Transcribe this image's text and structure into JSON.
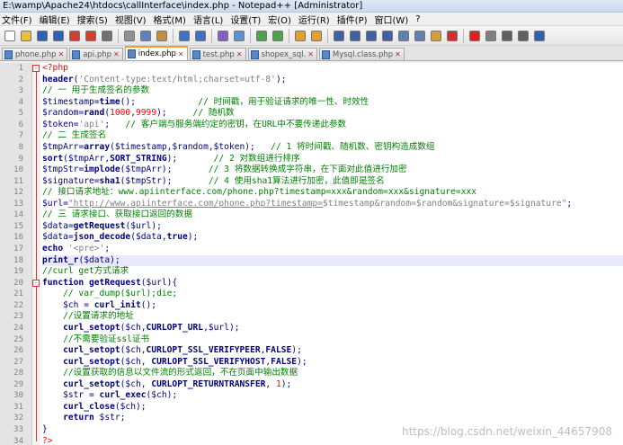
{
  "window": {
    "title": "E:\\wamp\\Apache24\\htdocs\\callInterface\\index.php - Notepad++ [Administrator]"
  },
  "menu": [
    "文件(F)",
    "编辑(E)",
    "搜索(S)",
    "视图(V)",
    "格式(M)",
    "语言(L)",
    "设置(T)",
    "宏(O)",
    "运行(R)",
    "插件(P)",
    "窗口(W)",
    "?"
  ],
  "toolbar_icons": [
    {
      "name": "new-file-icon",
      "color": "#ffffff"
    },
    {
      "name": "open-file-icon",
      "color": "#e8c040"
    },
    {
      "name": "save-icon",
      "color": "#3060b0"
    },
    {
      "name": "save-all-icon",
      "color": "#3060b0"
    },
    {
      "name": "close-icon",
      "color": "#d04030"
    },
    {
      "name": "close-all-icon",
      "color": "#d04030"
    },
    {
      "name": "print-icon",
      "color": "#707070"
    },
    {
      "sep": true
    },
    {
      "name": "cut-icon",
      "color": "#909090"
    },
    {
      "name": "copy-icon",
      "color": "#6080c0"
    },
    {
      "name": "paste-icon",
      "color": "#c09040"
    },
    {
      "sep": true
    },
    {
      "name": "undo-icon",
      "color": "#4070c0"
    },
    {
      "name": "redo-icon",
      "color": "#4070c0"
    },
    {
      "sep": true
    },
    {
      "name": "find-icon",
      "color": "#8060c0"
    },
    {
      "name": "replace-icon",
      "color": "#6090d0"
    },
    {
      "sep": true
    },
    {
      "name": "zoom-in-icon",
      "color": "#50a050"
    },
    {
      "name": "zoom-out-icon",
      "color": "#50a050"
    },
    {
      "sep": true
    },
    {
      "name": "sync-v-icon",
      "color": "#e0a030"
    },
    {
      "name": "sync-h-icon",
      "color": "#e0a030"
    },
    {
      "sep": true
    },
    {
      "name": "word-wrap-icon",
      "color": "#4060a0"
    },
    {
      "name": "all-chars-icon",
      "color": "#4060a0"
    },
    {
      "name": "indent-guide-icon",
      "color": "#4060a0"
    },
    {
      "name": "user-lang-icon",
      "color": "#4060a0"
    },
    {
      "name": "doc-map-icon",
      "color": "#6080b0"
    },
    {
      "name": "function-list-icon",
      "color": "#6080b0"
    },
    {
      "name": "folder-workspace-icon",
      "color": "#d0a040"
    },
    {
      "name": "monitor-icon",
      "color": "#d03030"
    },
    {
      "sep": true
    },
    {
      "name": "record-macro-icon",
      "color": "#e02020"
    },
    {
      "name": "stop-macro-icon",
      "color": "#808080"
    },
    {
      "name": "play-macro-icon",
      "color": "#606060"
    },
    {
      "name": "run-macro-icon",
      "color": "#606060"
    },
    {
      "name": "save-macro-icon",
      "color": "#3060b0"
    }
  ],
  "tabs": [
    {
      "label": "phone.php",
      "active": false
    },
    {
      "label": "api.php",
      "active": false
    },
    {
      "label": "index.php",
      "active": true
    },
    {
      "label": "test.php",
      "active": false
    },
    {
      "label": "shopex_sql.",
      "active": false
    },
    {
      "label": "Mysql.class.php",
      "active": false
    }
  ],
  "code_lines": [
    [
      [
        "c-php",
        "<?php"
      ]
    ],
    [
      [
        "c-kw",
        "header"
      ],
      [
        "c-plain",
        "("
      ],
      [
        "c-str",
        "'Content-type:text/html;charset=utf-8'"
      ],
      [
        "c-plain",
        ");"
      ]
    ],
    [
      [
        "c-com",
        "// 一 用于生成签名的参数"
      ]
    ],
    [
      [
        "c-var",
        "$timestamp"
      ],
      [
        "c-plain",
        "="
      ],
      [
        "c-kw",
        "time"
      ],
      [
        "c-plain",
        "();            "
      ],
      [
        "c-com",
        "// 时间戳，用于验证请求的唯一性、时效性"
      ]
    ],
    [
      [
        "c-var",
        "$random"
      ],
      [
        "c-plain",
        "="
      ],
      [
        "c-kw",
        "rand"
      ],
      [
        "c-plain",
        "("
      ],
      [
        "c-num",
        "1000"
      ],
      [
        "c-plain",
        ","
      ],
      [
        "c-num",
        "9999"
      ],
      [
        "c-plain",
        ");     "
      ],
      [
        "c-com",
        "// 随机数"
      ]
    ],
    [
      [
        "c-var",
        "$token"
      ],
      [
        "c-plain",
        "="
      ],
      [
        "c-str",
        "'api'"
      ],
      [
        "c-plain",
        ";   "
      ],
      [
        "c-com",
        "// 客户端与服务端约定的密钥，在URL中不要传递此参数"
      ]
    ],
    [
      [
        "c-com",
        "// 二 生成签名"
      ]
    ],
    [
      [
        "c-var",
        "$tmpArr"
      ],
      [
        "c-plain",
        "="
      ],
      [
        "c-kw",
        "array"
      ],
      [
        "c-plain",
        "($timestamp,$random,$token);   "
      ],
      [
        "c-com",
        "// 1 将时间戳、随机数、密钥构造成数组"
      ]
    ],
    [
      [
        "c-kw",
        "sort"
      ],
      [
        "c-plain",
        "($tmpArr,"
      ],
      [
        "c-kw",
        "SORT_STRING"
      ],
      [
        "c-plain",
        ");       "
      ],
      [
        "c-com",
        "// 2 对数组进行排序"
      ]
    ],
    [
      [
        "c-var",
        "$tmpStr"
      ],
      [
        "c-plain",
        "="
      ],
      [
        "c-kw",
        "implode"
      ],
      [
        "c-plain",
        "($tmpArr);       "
      ],
      [
        "c-com",
        "// 3 将数据转换成字符串，在下面对此值进行加密"
      ]
    ],
    [
      [
        "c-var",
        "$signature"
      ],
      [
        "c-plain",
        "="
      ],
      [
        "c-kw",
        "sha1"
      ],
      [
        "c-plain",
        "($tmpStr);       "
      ],
      [
        "c-com",
        "// 4 使用sha1算法进行加密，此值即是签名"
      ]
    ],
    [
      [
        "c-com",
        "// 接口请求地址：www.apiinterface.com/phone.php?timestamp=xxx&random=xxx&signature=xxx"
      ]
    ],
    [
      [
        "c-var",
        "$url"
      ],
      [
        "c-plain",
        "="
      ],
      [
        "c-url",
        "\"http://www.apiinterface.com/phone.php?timestamp="
      ],
      [
        "c-str",
        "$timestamp&random=$random&signature=$signature\""
      ],
      [
        "c-plain",
        ";"
      ]
    ],
    [
      [
        "c-com",
        "// 三 请求接口、获取接口返回的数据"
      ]
    ],
    [
      [
        "c-var",
        "$data"
      ],
      [
        "c-plain",
        "="
      ],
      [
        "c-kw",
        "getRequest"
      ],
      [
        "c-plain",
        "($url);"
      ]
    ],
    [
      [
        "c-var",
        "$data"
      ],
      [
        "c-plain",
        "="
      ],
      [
        "c-kw",
        "json_decode"
      ],
      [
        "c-plain",
        "($data,"
      ],
      [
        "c-kw",
        "true"
      ],
      [
        "c-plain",
        ");"
      ]
    ],
    [
      [
        "c-kw",
        "echo"
      ],
      [
        "c-plain",
        " "
      ],
      [
        "c-str",
        "'<pre>'"
      ],
      [
        "c-plain",
        ";"
      ]
    ],
    [
      [
        "c-kw",
        "print_r"
      ],
      [
        "c-plain",
        "($data);"
      ]
    ],
    [
      [
        "c-com",
        "//curl get方式请求"
      ]
    ],
    [
      [
        "c-kw",
        "function"
      ],
      [
        "c-plain",
        " "
      ],
      [
        "c-kw",
        "getRequest"
      ],
      [
        "c-plain",
        "($url){"
      ]
    ],
    [
      [
        "c-plain",
        "    "
      ],
      [
        "c-com",
        "// var_dump($url);die;"
      ]
    ],
    [
      [
        "c-plain",
        "    "
      ],
      [
        "c-var",
        "$ch"
      ],
      [
        "c-plain",
        " = "
      ],
      [
        "c-kw",
        "curl_init"
      ],
      [
        "c-plain",
        "();"
      ]
    ],
    [
      [
        "c-plain",
        "    "
      ],
      [
        "c-com",
        "//设置请求的地址"
      ]
    ],
    [
      [
        "c-plain",
        "    "
      ],
      [
        "c-kw",
        "curl_setopt"
      ],
      [
        "c-plain",
        "($ch,"
      ],
      [
        "c-kw",
        "CURLOPT_URL"
      ],
      [
        "c-plain",
        ",$url);"
      ]
    ],
    [
      [
        "c-plain",
        "    "
      ],
      [
        "c-com",
        "//不需要验证ssl证书"
      ]
    ],
    [
      [
        "c-plain",
        "    "
      ],
      [
        "c-kw",
        "curl_setopt"
      ],
      [
        "c-plain",
        "($ch,"
      ],
      [
        "c-kw",
        "CURLOPT_SSL_VERIFYPEER"
      ],
      [
        "c-plain",
        ","
      ],
      [
        "c-kw",
        "FALSE"
      ],
      [
        "c-plain",
        ");"
      ]
    ],
    [
      [
        "c-plain",
        "    "
      ],
      [
        "c-kw",
        "curl_setopt"
      ],
      [
        "c-plain",
        "($ch, "
      ],
      [
        "c-kw",
        "CURLOPT_SSL_VERIFYHOST"
      ],
      [
        "c-plain",
        ","
      ],
      [
        "c-kw",
        "FALSE"
      ],
      [
        "c-plain",
        ");"
      ]
    ],
    [
      [
        "c-plain",
        "    "
      ],
      [
        "c-com",
        "//设置获取的信息以文件流的形式返回，不在页面中输出数据"
      ]
    ],
    [
      [
        "c-plain",
        "    "
      ],
      [
        "c-kw",
        "curl_setopt"
      ],
      [
        "c-plain",
        "($ch, "
      ],
      [
        "c-kw",
        "CURLOPT_RETURNTRANSFER"
      ],
      [
        "c-plain",
        ", "
      ],
      [
        "c-num",
        "1"
      ],
      [
        "c-plain",
        ");"
      ]
    ],
    [
      [
        "c-plain",
        "    "
      ],
      [
        "c-var",
        "$str"
      ],
      [
        "c-plain",
        " = "
      ],
      [
        "c-kw",
        "curl_exec"
      ],
      [
        "c-plain",
        "($ch);"
      ]
    ],
    [
      [
        "c-plain",
        "    "
      ],
      [
        "c-kw",
        "curl_close"
      ],
      [
        "c-plain",
        "($ch);"
      ]
    ],
    [
      [
        "c-plain",
        "    "
      ],
      [
        "c-kw",
        "return"
      ],
      [
        "c-plain",
        " $str;"
      ]
    ],
    [
      [
        "c-plain",
        "}"
      ]
    ],
    [
      [
        "c-php",
        "?>"
      ]
    ]
  ],
  "highlighted_line": 18,
  "watermark": "https://blog.csdn.net/weixin_44657908"
}
